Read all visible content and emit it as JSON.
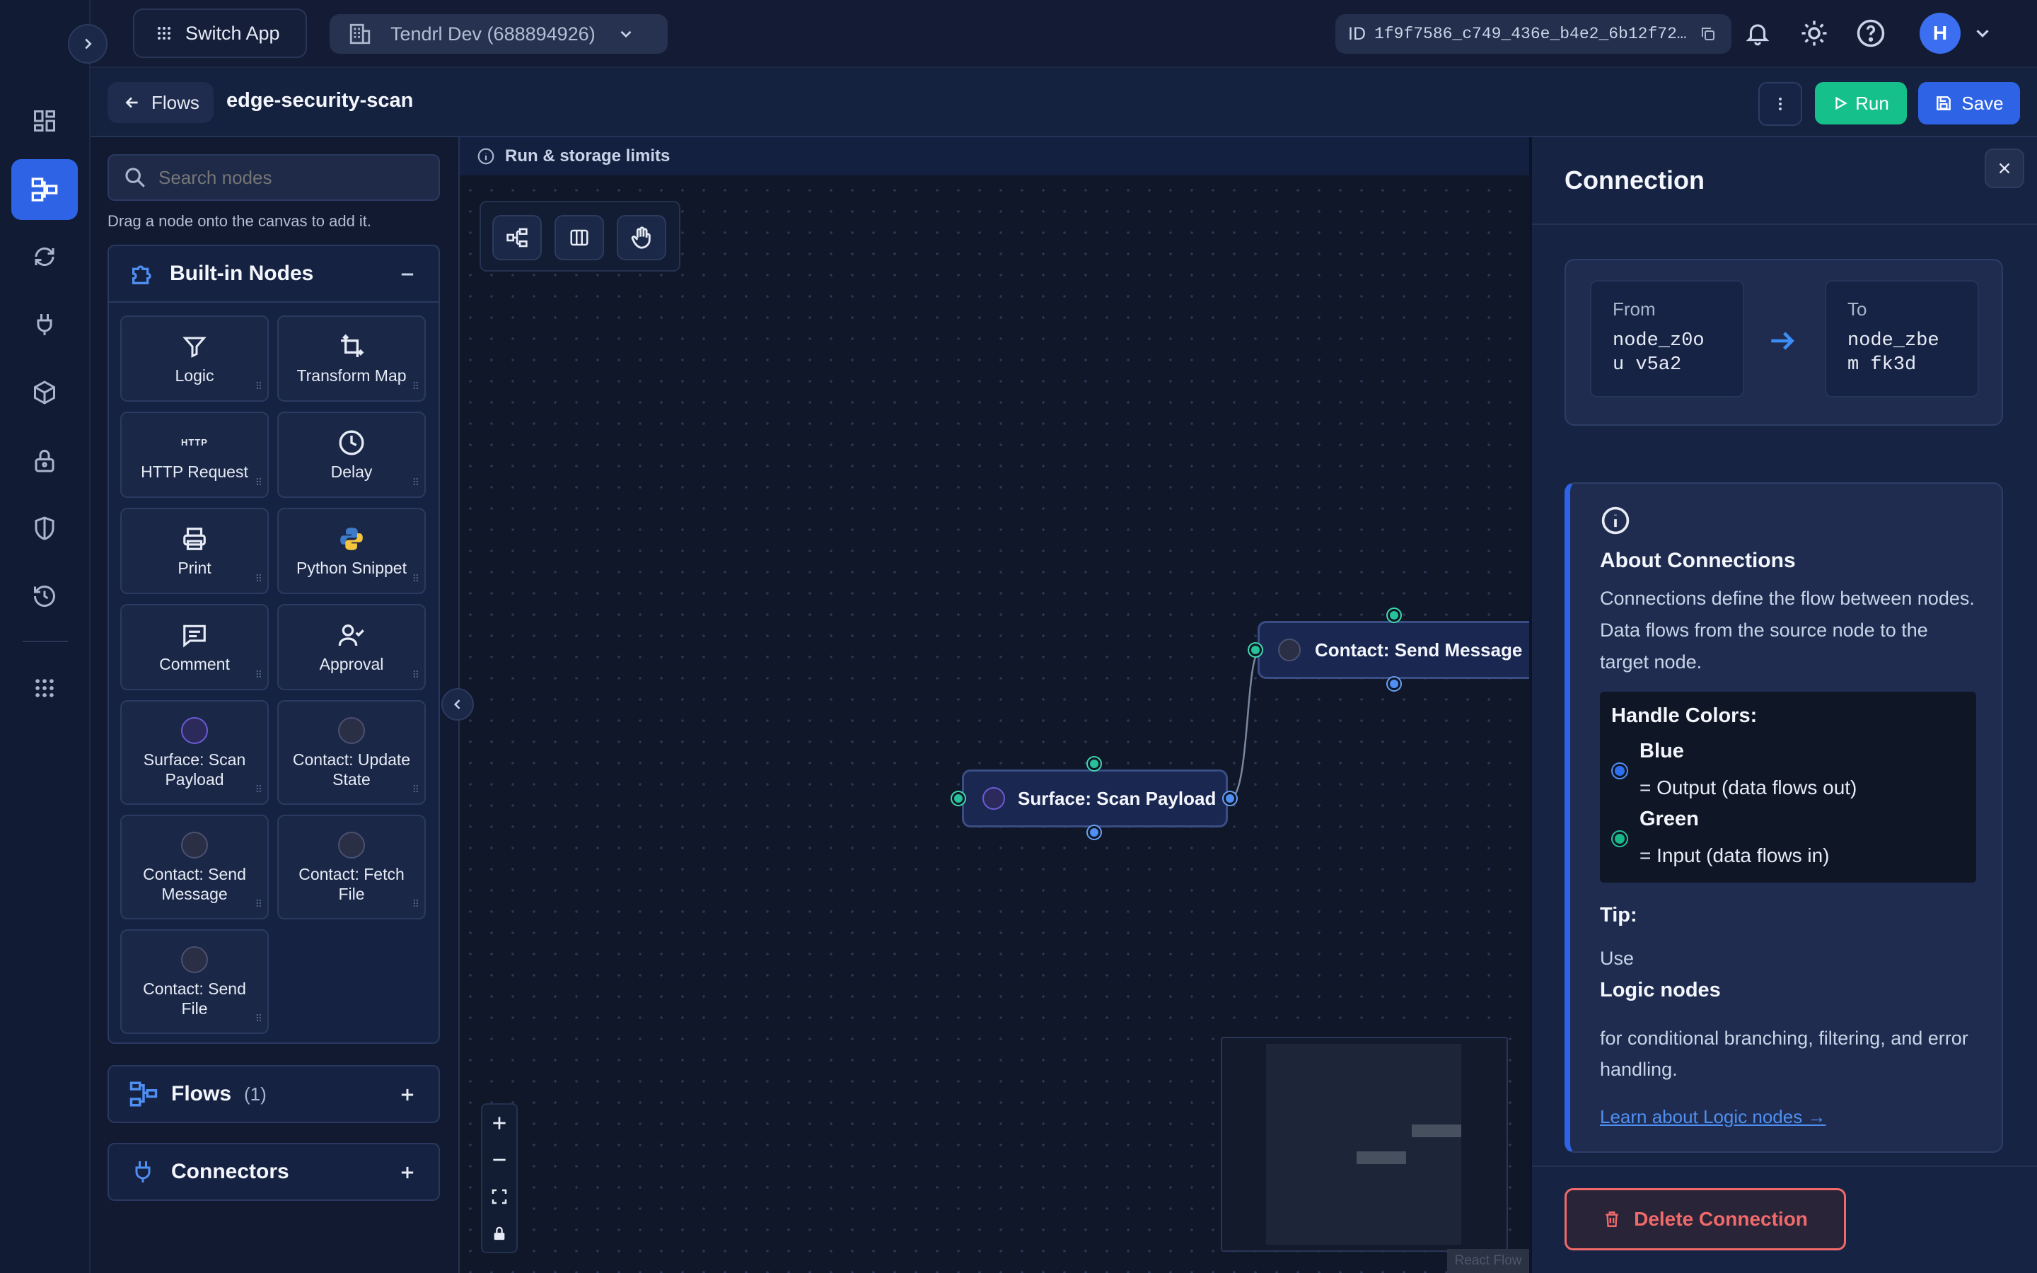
{
  "topbar": {
    "switch_app": "Switch App",
    "workspace": "Tendrl Dev (688894926)",
    "id_label": "ID",
    "id_value": "1f9f7586_c749_436e_b4e2_6b12f72…",
    "avatar_initial": "H"
  },
  "header": {
    "back_label": "Flows",
    "flow_name": "edge-security-scan",
    "run_label": "Run",
    "save_label": "Save"
  },
  "nodes_panel": {
    "search_placeholder": "Search nodes",
    "hint": "Drag a node onto the canvas to add it.",
    "builtin_title": "Built-in Nodes",
    "tiles": [
      {
        "label": "Logic",
        "icon": "filter-icon"
      },
      {
        "label": "Transform Map",
        "icon": "transform-icon"
      },
      {
        "label": "HTTP Request",
        "icon": "http-icon",
        "icon_text": "HTTP"
      },
      {
        "label": "Delay",
        "icon": "clock-icon"
      },
      {
        "label": "Print",
        "icon": "printer-icon"
      },
      {
        "label": "Python Snippet",
        "icon": "python-icon"
      },
      {
        "label": "Comment",
        "icon": "comment-icon"
      },
      {
        "label": "Approval",
        "icon": "user-check-icon"
      },
      {
        "label": "Surface: Scan Payload",
        "icon": "surface-badge-icon"
      },
      {
        "label": "Contact: Update State",
        "icon": "contact-badge-icon"
      },
      {
        "label": "Contact: Send Message",
        "icon": "contact-badge-icon"
      },
      {
        "label": "Contact: Fetch File",
        "icon": "contact-badge-icon"
      },
      {
        "label": "Contact: Send File",
        "icon": "contact-badge-icon"
      }
    ],
    "flows_title": "Flows",
    "flows_count": "(1)",
    "connectors_title": "Connectors"
  },
  "canvas": {
    "limits_label": "Run & storage limits",
    "nodes": [
      {
        "label": "Contact: Send Message"
      },
      {
        "label": "Surface: Scan Payload"
      }
    ],
    "attribution": "React Flow"
  },
  "connection_panel": {
    "title": "Connection",
    "from_label": "From",
    "from_value": "node_z0ou v5a2",
    "to_label": "To",
    "to_value": "node_zbem fk3d",
    "about_title": "About Connections",
    "about_text": "Connections define the flow between nodes. Data flows from the source node to the target node.",
    "handle_colors_title": "Handle Colors:",
    "blue_label": "Blue",
    "blue_desc": "= Output (data flows out)",
    "green_label": "Green",
    "green_desc": "= Input (data flows in)",
    "tip_title": "Tip:",
    "tip_use": "Use",
    "tip_strong": "Logic nodes",
    "tip_text": "for conditional branching, filtering, and error handling.",
    "learn_link": "Learn about Logic nodes →",
    "delete_label": "Delete Connection"
  },
  "colors": {
    "accent_blue": "#2e63e5",
    "run_green": "#16c08a",
    "delete_red": "#f06a6a",
    "output_blue": "#4f8ff2",
    "input_green": "#27c29a"
  }
}
